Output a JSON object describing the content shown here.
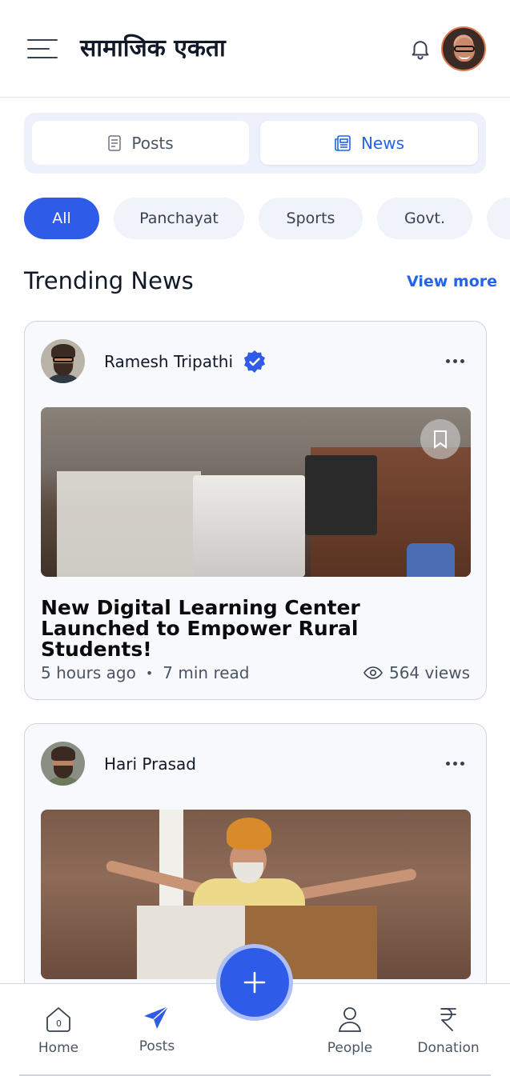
{
  "header": {
    "title": "सामाजिक एकता",
    "menu_icon": "hamburger-menu-icon",
    "bell_icon": "bell-icon"
  },
  "tabs": [
    {
      "label": "Posts",
      "icon": "document-icon",
      "active": false
    },
    {
      "label": "News",
      "icon": "newspaper-icon",
      "active": true
    }
  ],
  "chips": [
    "All",
    "Panchayat",
    "Sports",
    "Govt."
  ],
  "section": {
    "title": "Trending News",
    "view_more": "View more"
  },
  "cards": [
    {
      "author": "Ramesh Tripathi",
      "verified": true,
      "headline": "New Digital Learning Center Launched to Empower Rural Students!",
      "time": "5 hours ago",
      "read": "7 min read",
      "views": "564 views"
    },
    {
      "author": "Hari Prasad",
      "verified": false
    }
  ],
  "nav": {
    "home": "Home",
    "posts": "Posts",
    "people": "People",
    "donation": "Donation"
  },
  "colors": {
    "accent": "#2f5be9",
    "text": "#111827",
    "muted": "#4b5563"
  }
}
